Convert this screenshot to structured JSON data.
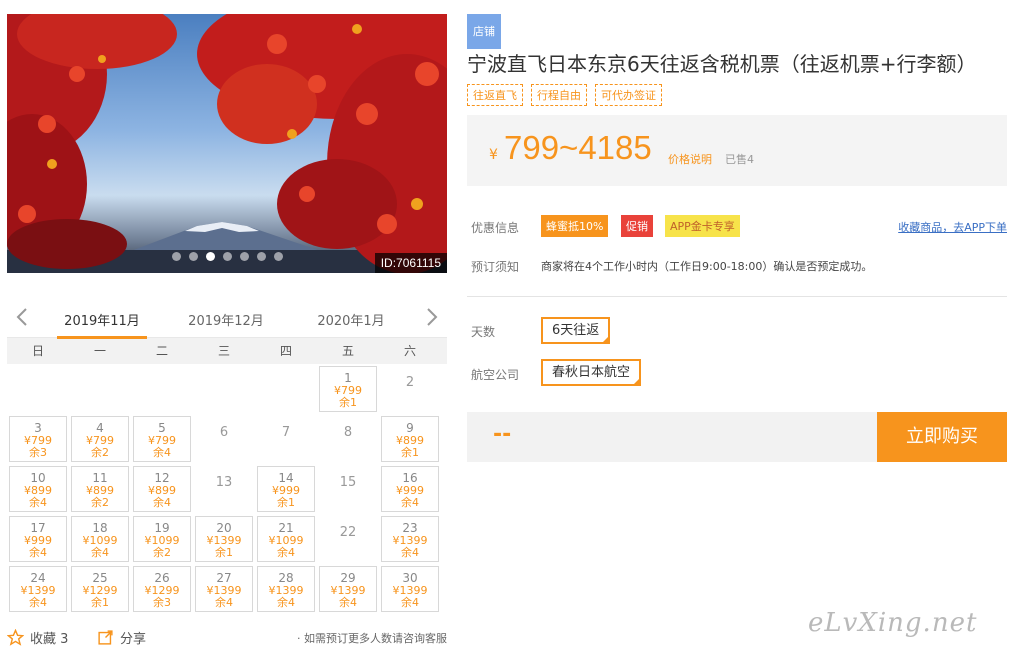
{
  "product": {
    "shop_badge": "店铺",
    "title": "宁波直飞日本东京6天往返含税机票（往返机票+行李额）",
    "tags": [
      "往返直飞",
      "行程自由",
      "可代办签证"
    ],
    "image_id": "ID:7061115",
    "slide_count": 7,
    "active_slide": 3
  },
  "price": {
    "currency": "¥",
    "range": "799~4185",
    "note_link": "价格说明",
    "sold": "已售4"
  },
  "promotions": {
    "label": "优惠信息",
    "items": [
      {
        "text": "蜂蜜抵10%",
        "color": "#f7941d"
      },
      {
        "text": "促销",
        "color": "#e9423a"
      },
      {
        "text": "APP金卡专享",
        "color": "#f7e34a"
      }
    ],
    "collect_link": "收藏商品，去APP下单"
  },
  "booking_notice": {
    "label": "预订须知",
    "text": "商家将在4个工作小时内（工作日9:00-18:00）确认是否预定成功。"
  },
  "options": {
    "days_label": "天数",
    "days_value": "6天往返",
    "airline_label": "航空公司",
    "airline_value": "春秋日本航空"
  },
  "purchase": {
    "total": "--",
    "buy_label": "立即购买"
  },
  "calendar": {
    "months": [
      "2019年11月",
      "2019年12月",
      "2020年1月"
    ],
    "active_month": 0,
    "weekdays": [
      "日",
      "一",
      "二",
      "三",
      "四",
      "五",
      "六"
    ],
    "days": [
      {
        "day": 1,
        "price": "¥799",
        "remain": "余1"
      },
      {
        "day": 2
      },
      {
        "day": 3,
        "price": "¥799",
        "remain": "余3"
      },
      {
        "day": 4,
        "price": "¥799",
        "remain": "余2"
      },
      {
        "day": 5,
        "price": "¥799",
        "remain": "余4"
      },
      {
        "day": 6
      },
      {
        "day": 7
      },
      {
        "day": 8
      },
      {
        "day": 9,
        "price": "¥899",
        "remain": "余1"
      },
      {
        "day": 10,
        "price": "¥899",
        "remain": "余4"
      },
      {
        "day": 11,
        "price": "¥899",
        "remain": "余2"
      },
      {
        "day": 12,
        "price": "¥899",
        "remain": "余4"
      },
      {
        "day": 13
      },
      {
        "day": 14,
        "price": "¥999",
        "remain": "余1"
      },
      {
        "day": 15
      },
      {
        "day": 16,
        "price": "¥999",
        "remain": "余4"
      },
      {
        "day": 17,
        "price": "¥999",
        "remain": "余4"
      },
      {
        "day": 18,
        "price": "¥1099",
        "remain": "余4"
      },
      {
        "day": 19,
        "price": "¥1099",
        "remain": "余2"
      },
      {
        "day": 20,
        "price": "¥1399",
        "remain": "余1"
      },
      {
        "day": 21,
        "price": "¥1099",
        "remain": "余4"
      },
      {
        "day": 22
      },
      {
        "day": 23,
        "price": "¥1399",
        "remain": "余4"
      },
      {
        "day": 24,
        "price": "¥1399",
        "remain": "余4"
      },
      {
        "day": 25,
        "price": "¥1299",
        "remain": "余1"
      },
      {
        "day": 26,
        "price": "¥1299",
        "remain": "余3"
      },
      {
        "day": 27,
        "price": "¥1399",
        "remain": "余4"
      },
      {
        "day": 28,
        "price": "¥1399",
        "remain": "余4"
      },
      {
        "day": 29,
        "price": "¥1399",
        "remain": "余4"
      },
      {
        "day": 30,
        "price": "¥1399",
        "remain": "余4"
      }
    ]
  },
  "footer": {
    "favorite_label": "收藏 3",
    "share_label": "分享",
    "group_note": "· 如需预订更多人数请咨询客服"
  },
  "watermark": "eLvXing.net",
  "colors": {
    "accent": "#f7941d",
    "badge": "#7aa7e8",
    "link": "#3a6fc4"
  }
}
